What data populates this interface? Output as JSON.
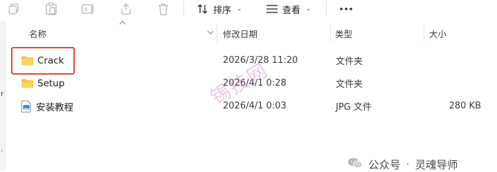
{
  "toolbar": {
    "sort_label": "排序",
    "view_label": "查看",
    "icons": [
      "copy-icon",
      "paste-icon",
      "rename-icon",
      "share-icon",
      "delete-icon",
      "sort-icon",
      "view-icon",
      "more-icon"
    ]
  },
  "columns": {
    "name": "名称",
    "modified": "修改日期",
    "type": "类型",
    "size": "大小"
  },
  "files": [
    {
      "name": "Crack",
      "modified": "2026/3/28 11:20",
      "type": "文件夹",
      "size": "",
      "icon": "folder-icon"
    },
    {
      "name": "Setup",
      "modified": "2026/4/1 0:28",
      "type": "文件夹",
      "size": "",
      "icon": "folder-icon"
    },
    {
      "name": "安装教程",
      "modified": "2026/4/1 0:03",
      "type": "JPG 文件",
      "size": "280 KB",
      "icon": "image-file-icon"
    }
  ],
  "watermark": "锡技网",
  "footer": {
    "brand": "公众号",
    "separator": "·",
    "author": "灵魂导师"
  },
  "colors": {
    "highlight_border": "#e8453c",
    "folder": "#f5c244",
    "watermark": "#c36bb8"
  }
}
